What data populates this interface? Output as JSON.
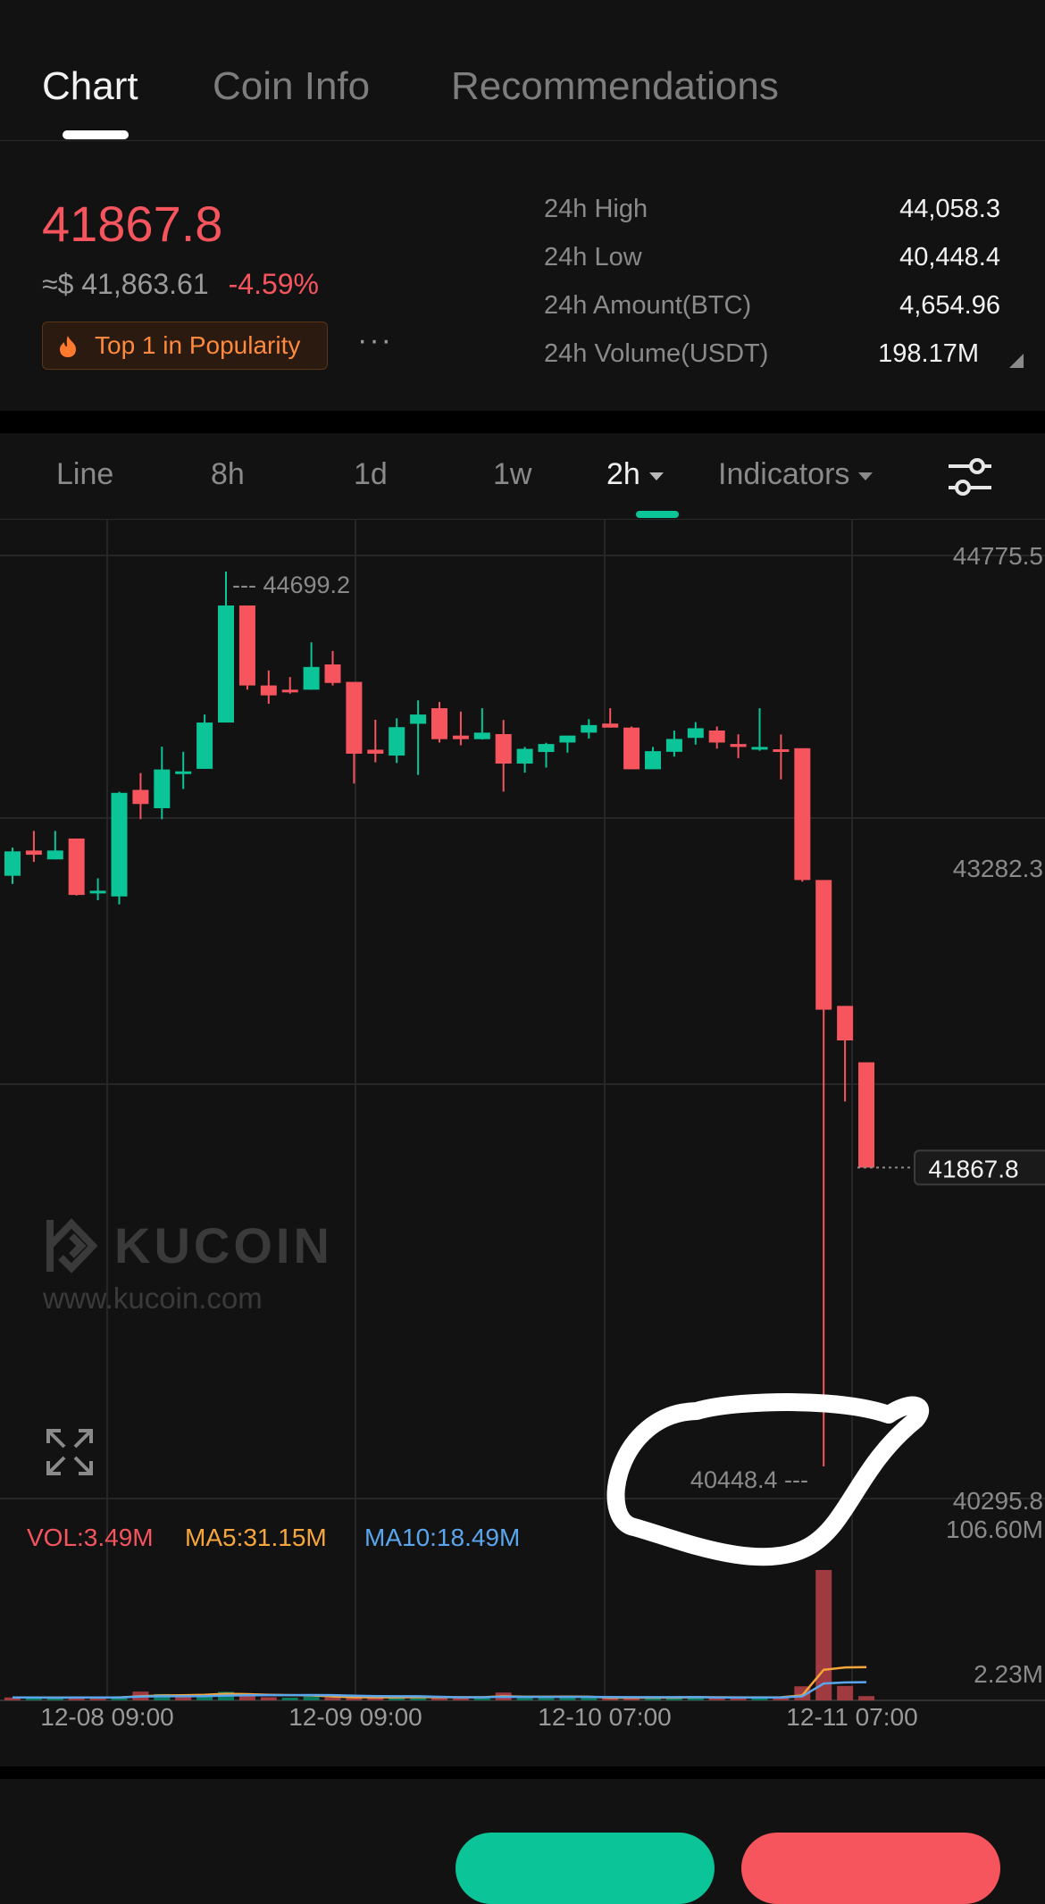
{
  "tabs": [
    "Chart",
    "Coin Info",
    "Recommendations"
  ],
  "ticker": {
    "price": "41867.8",
    "usd_price": "≈$ 41,863.61",
    "change": "-4.59%",
    "badge": "Top 1 in Popularity",
    "more": "···"
  },
  "stats": [
    {
      "label": "24h High",
      "value": "44,058.3"
    },
    {
      "label": "24h Low",
      "value": "40,448.4"
    },
    {
      "label": "24h Amount(BTC)",
      "value": "4,654.96"
    },
    {
      "label": "24h Volume(USDT)",
      "value": "198.17M"
    }
  ],
  "timeframes": [
    "Line",
    "8h",
    "1d",
    "1w",
    "2h",
    "Indicators"
  ],
  "active_timeframe": "2h",
  "watermark": {
    "brand": "KUCOIN",
    "url": "www.kucoin.com"
  },
  "volume": {
    "vol": "VOL:3.49M",
    "ma5": "MA5:31.15M",
    "ma10": "MA10:18.49M"
  },
  "colors": {
    "up": "#0bc497",
    "down": "#f6555e",
    "ma5": "#f7a63b",
    "ma10": "#5aa6ee"
  },
  "chart_data": {
    "type": "candlestick",
    "interval": "2h",
    "y_ticks": [
      "44775.5",
      "43282.3",
      "40295.8"
    ],
    "vol_ticks": [
      "106.60M",
      "2.23M"
    ],
    "x_ticks": [
      "12-08 09:00",
      "12-09 09:00",
      "12-10 07:00",
      "12-11 07:00"
    ],
    "high_label": "44699.2",
    "low_label": "40448.4",
    "last_price_label": "41867.8",
    "ylim": [
      40295.8,
      44775.5
    ],
    "candles": [
      {
        "o": 43254,
        "h": 43388,
        "l": 43215,
        "c": 43370
      },
      {
        "o": 43374,
        "h": 43467,
        "l": 43320,
        "c": 43354
      },
      {
        "o": 43332,
        "h": 43467,
        "l": 43332,
        "c": 43374
      },
      {
        "o": 43431,
        "h": 43427,
        "l": 43160,
        "c": 43163
      },
      {
        "o": 43183,
        "h": 43242,
        "l": 43138,
        "c": 43183
      },
      {
        "o": 43156,
        "h": 43653,
        "l": 43118,
        "c": 43648
      },
      {
        "o": 43662,
        "h": 43742,
        "l": 43523,
        "c": 43595
      },
      {
        "o": 43575,
        "h": 43867,
        "l": 43523,
        "c": 43759
      },
      {
        "o": 43750,
        "h": 43843,
        "l": 43666,
        "c": 43750
      },
      {
        "o": 43762,
        "h": 44020,
        "l": 43762,
        "c": 43982
      },
      {
        "o": 43982,
        "h": 44699.2,
        "l": 43982,
        "c": 44538
      },
      {
        "o": 44538,
        "h": 44538,
        "l": 44138,
        "c": 44158
      },
      {
        "o": 44158,
        "h": 44229,
        "l": 44071,
        "c": 44111
      },
      {
        "o": 44138,
        "h": 44198,
        "l": 44119,
        "c": 44132
      },
      {
        "o": 44138,
        "h": 44363,
        "l": 44138,
        "c": 44246
      },
      {
        "o": 44258,
        "h": 44322,
        "l": 44158,
        "c": 44170
      },
      {
        "o": 44175,
        "h": 44170,
        "l": 43692,
        "c": 43834
      },
      {
        "o": 43853,
        "h": 43995,
        "l": 43793,
        "c": 43834
      },
      {
        "o": 43825,
        "h": 44002,
        "l": 43790,
        "c": 43960
      },
      {
        "o": 43976,
        "h": 44087,
        "l": 43733,
        "c": 44020
      },
      {
        "o": 44050,
        "h": 44080,
        "l": 43887,
        "c": 43903
      },
      {
        "o": 43920,
        "h": 44034,
        "l": 43874,
        "c": 43903
      },
      {
        "o": 43903,
        "h": 44050,
        "l": 43901,
        "c": 43934
      },
      {
        "o": 43927,
        "h": 43994,
        "l": 43654,
        "c": 43787
      },
      {
        "o": 43787,
        "h": 43866,
        "l": 43744,
        "c": 43857
      },
      {
        "o": 43842,
        "h": 43886,
        "l": 43768,
        "c": 43880
      },
      {
        "o": 43887,
        "h": 43918,
        "l": 43839,
        "c": 43920
      },
      {
        "o": 43934,
        "h": 43998,
        "l": 43906,
        "c": 43970
      },
      {
        "o": 43977,
        "h": 44050,
        "l": 43958,
        "c": 43958
      },
      {
        "o": 43958,
        "h": 43963,
        "l": 43760,
        "c": 43760
      },
      {
        "o": 43760,
        "h": 43866,
        "l": 43760,
        "c": 43846
      },
      {
        "o": 43843,
        "h": 43944,
        "l": 43820,
        "c": 43904
      },
      {
        "o": 43909,
        "h": 43984,
        "l": 43877,
        "c": 43955
      },
      {
        "o": 43944,
        "h": 43963,
        "l": 43858,
        "c": 43887
      },
      {
        "o": 43880,
        "h": 43926,
        "l": 43813,
        "c": 43866
      },
      {
        "o": 43855,
        "h": 44050,
        "l": 43848,
        "c": 43866
      },
      {
        "o": 43855,
        "h": 43925,
        "l": 43712,
        "c": 43853
      },
      {
        "o": 43860,
        "h": 43840,
        "l": 43226,
        "c": 43234
      },
      {
        "o": 43234,
        "h": 43234,
        "l": 40448.4,
        "c": 42618
      },
      {
        "o": 42636,
        "h": 42631,
        "l": 42182,
        "c": 42472
      },
      {
        "o": 42368,
        "h": 42368,
        "l": 42206,
        "c": 41867.8
      }
    ],
    "volume": [
      {
        "v": 2.4,
        "up": false
      },
      {
        "v": 2.3,
        "up": true
      },
      {
        "v": 2.2,
        "up": true
      },
      {
        "v": 2.5,
        "up": false
      },
      {
        "v": 2.3,
        "up": false
      },
      {
        "v": 2.8,
        "up": true
      },
      {
        "v": 7.2,
        "up": false
      },
      {
        "v": 5.2,
        "up": true
      },
      {
        "v": 3.4,
        "up": false
      },
      {
        "v": 4.2,
        "up": true
      },
      {
        "v": 7.0,
        "up": true
      },
      {
        "v": 5.6,
        "up": false
      },
      {
        "v": 2.6,
        "up": false
      },
      {
        "v": 2.2,
        "up": true
      },
      {
        "v": 3.2,
        "up": true
      },
      {
        "v": 2.4,
        "up": false
      },
      {
        "v": 2.3,
        "up": false
      },
      {
        "v": 2.1,
        "up": false
      },
      {
        "v": 2.4,
        "up": true
      },
      {
        "v": 3.9,
        "up": true
      },
      {
        "v": 2.2,
        "up": false
      },
      {
        "v": 2.1,
        "up": false
      },
      {
        "v": 2.3,
        "up": true
      },
      {
        "v": 6.4,
        "up": false
      },
      {
        "v": 2.2,
        "up": true
      },
      {
        "v": 2.1,
        "up": true
      },
      {
        "v": 2.3,
        "up": true
      },
      {
        "v": 2.1,
        "up": true
      },
      {
        "v": 2.2,
        "up": false
      },
      {
        "v": 2.4,
        "up": false
      },
      {
        "v": 2.2,
        "up": true
      },
      {
        "v": 2.3,
        "up": true
      },
      {
        "v": 3.6,
        "up": true
      },
      {
        "v": 2.2,
        "up": false
      },
      {
        "v": 2.1,
        "up": false
      },
      {
        "v": 2.2,
        "up": true
      },
      {
        "v": 2.6,
        "up": false
      },
      {
        "v": 11.5,
        "up": false
      },
      {
        "v": 106.6,
        "up": false
      },
      {
        "v": 11.8,
        "up": false
      },
      {
        "v": 3.49,
        "up": false
      }
    ]
  }
}
